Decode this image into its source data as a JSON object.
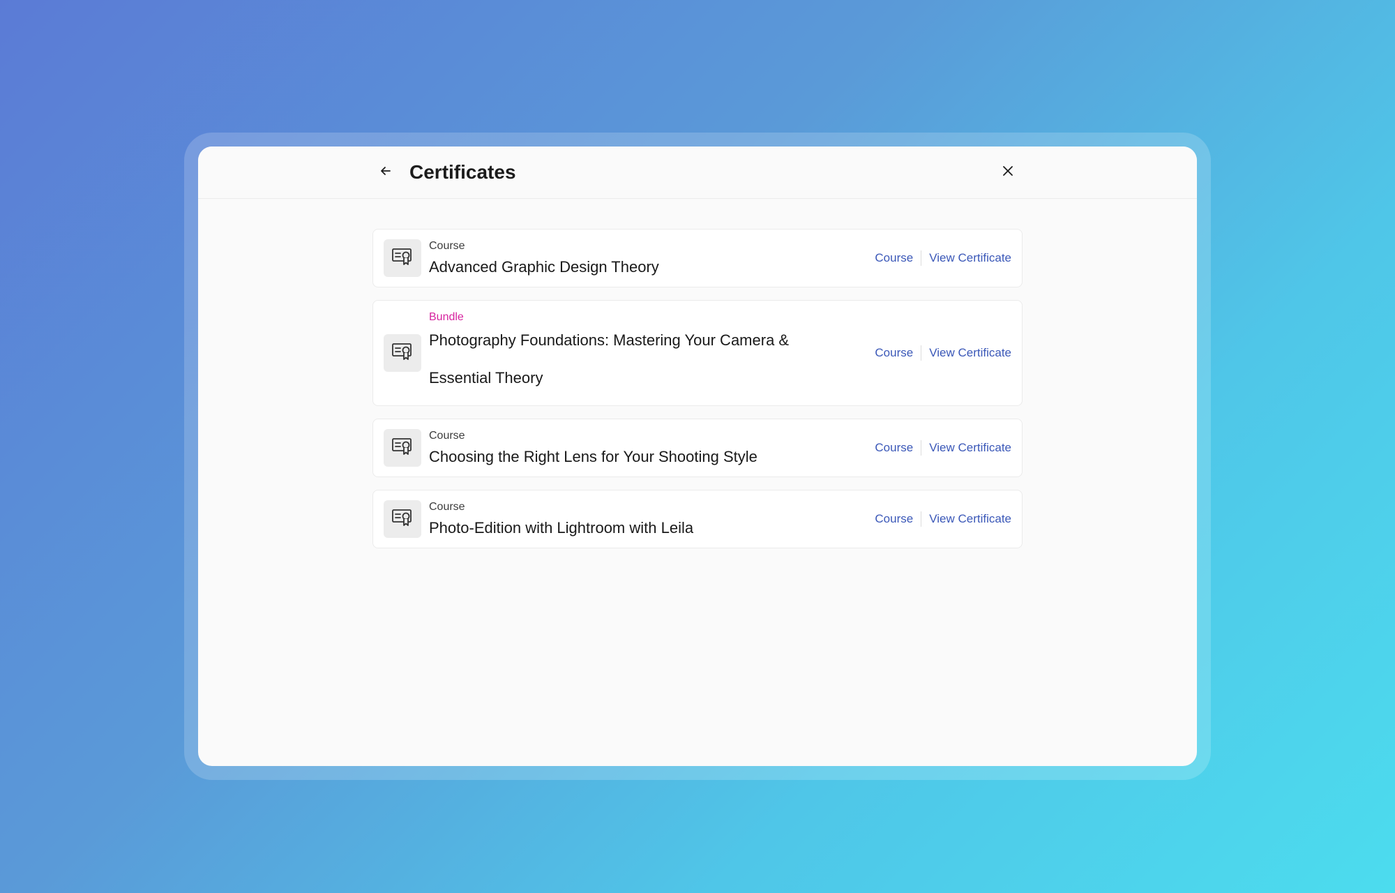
{
  "header": {
    "title": "Certificates",
    "back_icon": "arrow-left-icon",
    "close_icon": "close-icon"
  },
  "colors": {
    "accent_link": "#3b58b8",
    "bundle_tag": "#d6249f"
  },
  "certificates": [
    {
      "type": "Course",
      "name": "Advanced Graphic Design Theory",
      "course_link": "Course",
      "view_link": "View Certificate",
      "icon": "certificate-icon"
    },
    {
      "type": "Bundle",
      "name": "Photography Foundations: Mastering Your Camera & Essential Theory",
      "course_link": "Course",
      "view_link": "View Certificate",
      "icon": "certificate-icon"
    },
    {
      "type": "Course",
      "name": "Choosing the Right Lens for Your Shooting Style",
      "course_link": "Course",
      "view_link": "View Certificate",
      "icon": "certificate-icon"
    },
    {
      "type": "Course",
      "name": "Photo-Edition with Lightroom with Leila",
      "course_link": "Course",
      "view_link": "View Certificate",
      "icon": "certificate-icon"
    }
  ]
}
